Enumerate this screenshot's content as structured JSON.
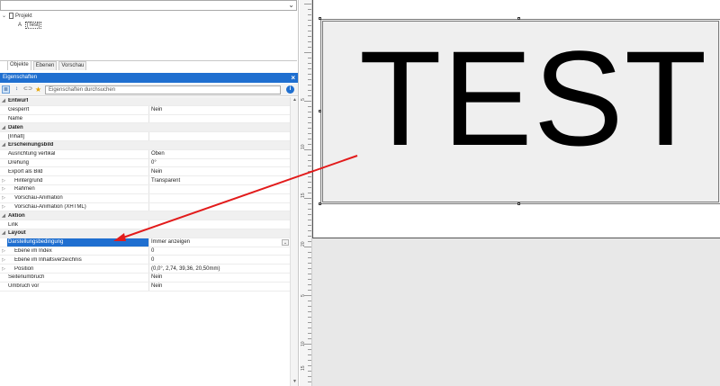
{
  "tree": {
    "root_label": "Projekt",
    "child_label": "[Test]"
  },
  "tabs": [
    "Objekte",
    "Ebenen",
    "Vorschau"
  ],
  "properties_panel": {
    "title": "Eigenschaften",
    "search_placeholder": "Eigenschaften durchsuchen",
    "rows": [
      {
        "kind": "cat",
        "label": "Entwurf"
      },
      {
        "kind": "prop",
        "label": "Gesperrt",
        "value": "Nein"
      },
      {
        "kind": "prop",
        "label": "Name",
        "value": ""
      },
      {
        "kind": "cat",
        "label": "Daten"
      },
      {
        "kind": "prop",
        "label": "[Inhalt]",
        "value": ""
      },
      {
        "kind": "cat",
        "label": "Erscheinungsbild"
      },
      {
        "kind": "prop",
        "label": "Ausrichtung vertikal",
        "value": "Oben"
      },
      {
        "kind": "prop",
        "label": "Drehung",
        "value": "0°"
      },
      {
        "kind": "prop",
        "label": "Export als Bild",
        "value": "Nein"
      },
      {
        "kind": "sub",
        "label": "Hintergrund",
        "value": "Transparent"
      },
      {
        "kind": "sub",
        "label": "Rahmen",
        "value": ""
      },
      {
        "kind": "sub",
        "label": "Vorschau-Animation",
        "value": ""
      },
      {
        "kind": "sub",
        "label": "Vorschau-Animation (XHTML)",
        "value": ""
      },
      {
        "kind": "cat",
        "label": "Aktion"
      },
      {
        "kind": "prop",
        "label": "Link",
        "value": ""
      },
      {
        "kind": "cat",
        "label": "Layout"
      },
      {
        "kind": "selected",
        "label": "Darstellungsbedingung",
        "value": "Immer anzeigen"
      },
      {
        "kind": "sub",
        "label": "Ebene im Index",
        "value": "0"
      },
      {
        "kind": "sub",
        "label": "Ebene im Inhaltsverzeichnis",
        "value": "0"
      },
      {
        "kind": "sub",
        "label": "Position",
        "value": "(0,0°, 2,74, 39,36, 20,50mm)"
      },
      {
        "kind": "prop",
        "label": "Seitenumbruch",
        "value": "Nein"
      },
      {
        "kind": "prop",
        "label": "Umbruch vor",
        "value": "Nein"
      }
    ]
  },
  "canvas": {
    "text_object": "TEST",
    "ruler_labels": [
      "5",
      "10",
      "15",
      "20",
      "5",
      "10",
      "15",
      "20"
    ]
  },
  "colors": {
    "accent": "#1f6fd0",
    "annotation_arrow": "#e21b1b"
  }
}
